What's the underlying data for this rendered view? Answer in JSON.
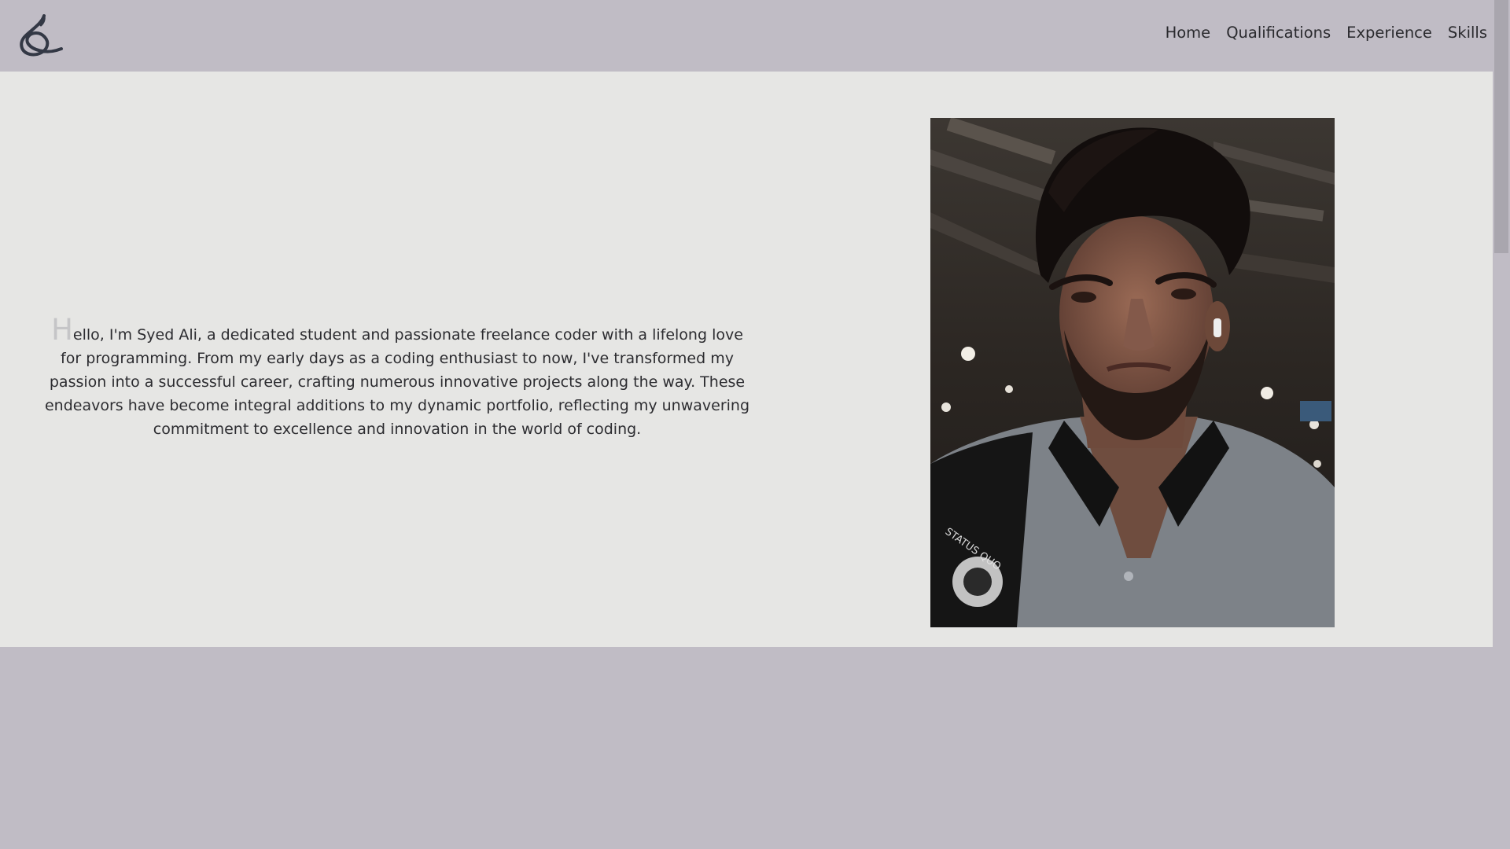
{
  "header": {
    "logo_icon": "ampersand-swirl-logo-icon",
    "nav": [
      {
        "label": "Home"
      },
      {
        "label": "Qualifications"
      },
      {
        "label": "Experience"
      },
      {
        "label": "Skills"
      }
    ]
  },
  "hero": {
    "intro_dropcap": "H",
    "intro_text": "ello, I'm Syed Ali, a dedicated student and passionate freelance coder with a lifelong love for programming. From my early days as a coding enthusiast to now, I've transformed my passion into a successful career, crafting numerous innovative projects along the way. These endeavors have become integral additions to my dynamic portfolio, reflecting my unwavering commitment to excellence and innovation in the world of coding.",
    "photo_icon": "portrait-photo"
  },
  "colors": {
    "header_bg": "#c0bcc5",
    "hero_bg": "#e6e6e4",
    "text": "#2c2c30",
    "dropcap": "#c5c5c7"
  }
}
